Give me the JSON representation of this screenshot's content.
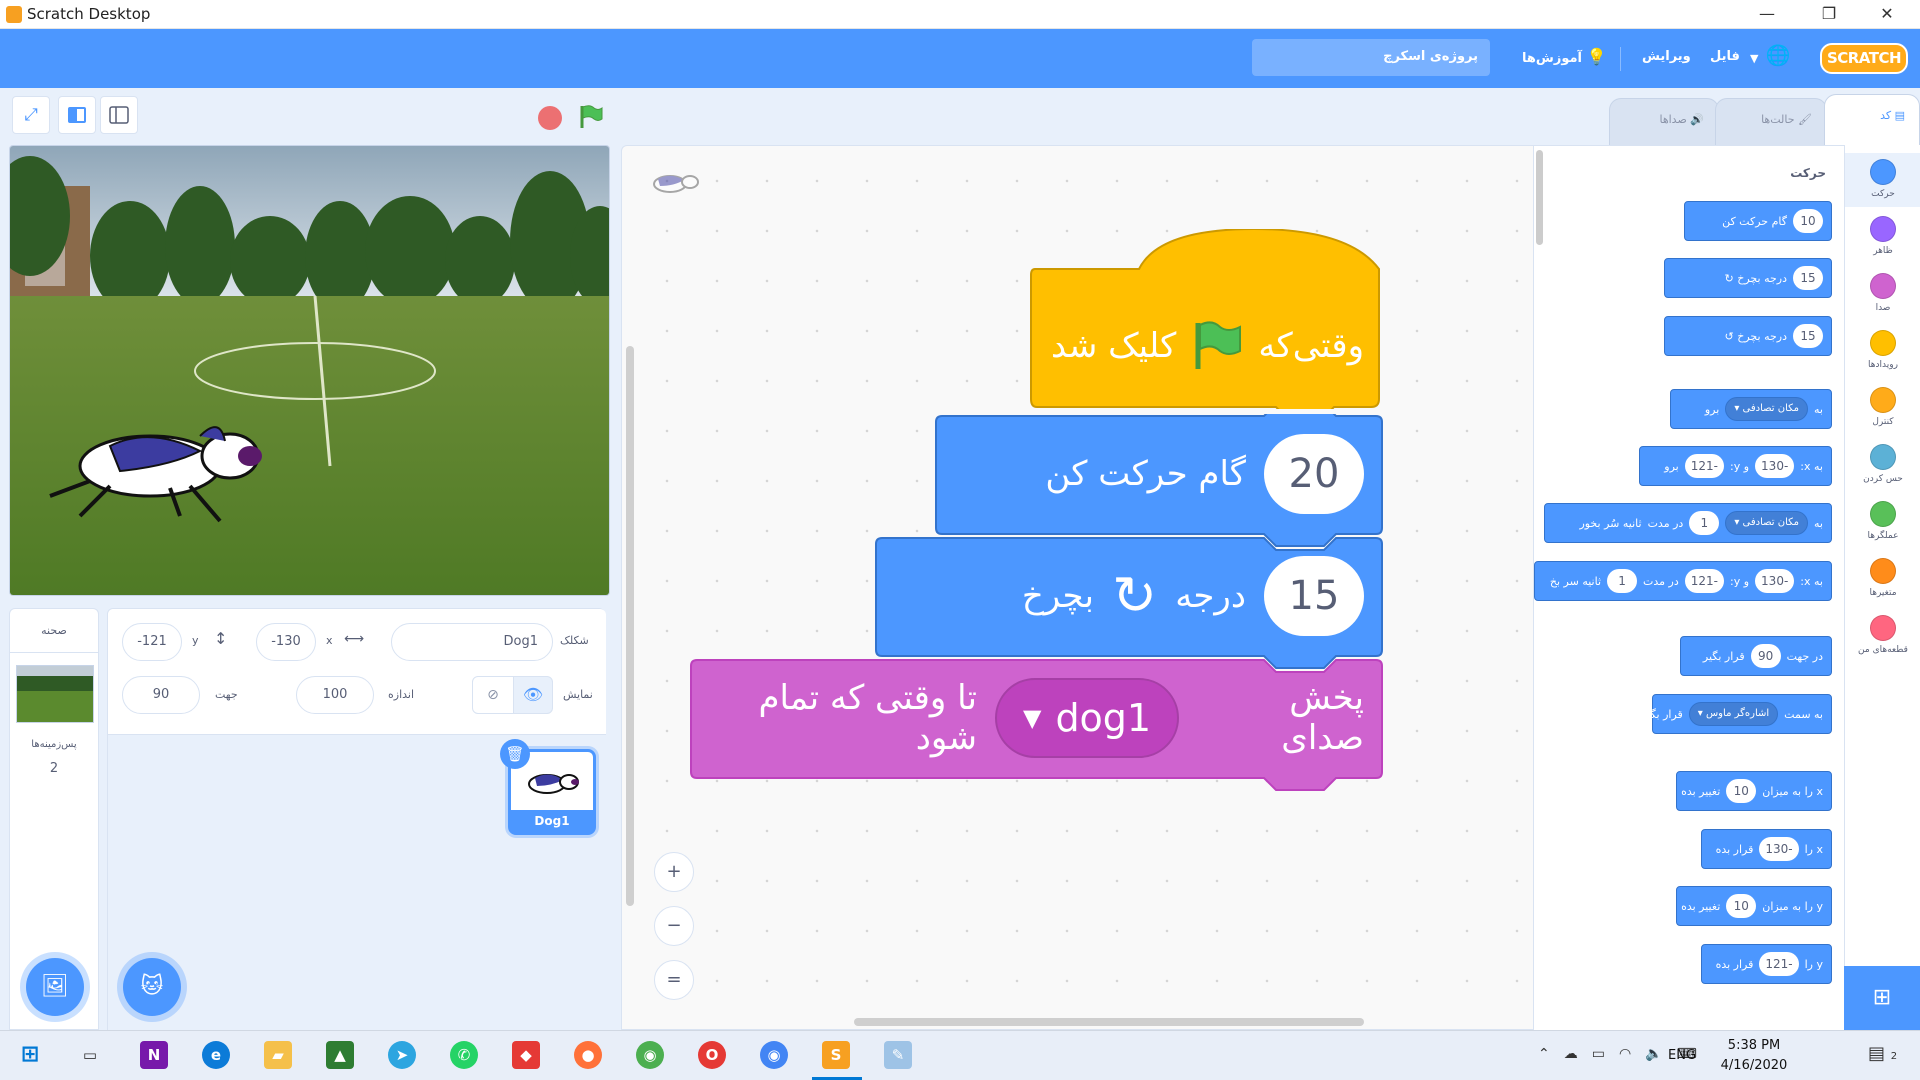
{
  "window": {
    "title": "Scratch Desktop",
    "minimize": "—",
    "restore": "❐",
    "close": "✕"
  },
  "menubar": {
    "logo": "SCRATCH",
    "file": "فایل",
    "edit": "ویرایش",
    "tutorials": "آموزش‌ها",
    "project_title": "پروژه‌ی اسکرچ"
  },
  "tabs": {
    "code": "کد",
    "costumes": "حالت‌ها",
    "sounds": "صداها"
  },
  "sprite_info": {
    "sprite_label": "شکلک",
    "sprite_name": "Dog1",
    "x_label": "x",
    "x_value": "-130",
    "y_label": "y",
    "y_value": "-121",
    "show_label": "نمایش",
    "size_label": "اندازه",
    "size_value": "100",
    "direction_label": "جهت",
    "direction_value": "90"
  },
  "stage_panel": {
    "header": "صحنه",
    "backdrops_label": "پس‌زمینه‌ها",
    "backdrops_count": "2"
  },
  "sprite_thumb": {
    "name": "Dog1"
  },
  "script": {
    "hat": {
      "before": "وقتی‌که",
      "after": "کلیک شد"
    },
    "move": {
      "value": "20",
      "text": "گام حرکت کن"
    },
    "turn": {
      "value": "15",
      "text1": "درجه",
      "text2": "بچرخ"
    },
    "sound": {
      "text1": "پخش صدای",
      "dropdown": "dog1",
      "text2": "تا وقتی که تمام شود"
    }
  },
  "palette": {
    "section_title": "حرکت",
    "blocks": [
      {
        "text": "گام حرکت کن",
        "value": "10"
      },
      {
        "text": "درجه بچرخ ↻",
        "value": "15"
      },
      {
        "text": "درجه بچرخ ↺",
        "value": "15"
      },
      {
        "pre": "به",
        "dropdown": "مکان تصادفی",
        "post": "برو"
      },
      {
        "pre": "به x:",
        "v1": "-130",
        "mid": "و y:",
        "v2": "-121",
        "post": "برو"
      },
      {
        "pre": "به",
        "dropdown": "مکان تصادفی",
        "mid": "در مدت",
        "v1": "1",
        "post": "ثانیه سُر بخور"
      },
      {
        "pre": "به x:",
        "v1": "-130",
        "mid": "و y:",
        "v2": "-121",
        "mid2": "در مدت",
        "v3": "1",
        "post": "ثانیه سر بخ"
      },
      {
        "pre": "در جهت",
        "v1": "90",
        "post": "قرار بگیر"
      },
      {
        "pre": "به سمت",
        "dropdown": "اشاره‌گر ماوس",
        "post": "قرار بگیر"
      },
      {
        "pre": "x را به میزان",
        "v1": "10",
        "post": "تغییر بده"
      },
      {
        "pre": "x را",
        "v1": "-130",
        "post": "قرار بده"
      },
      {
        "pre": "y را به میزان",
        "v1": "10",
        "post": "تغییر بده"
      },
      {
        "pre": "y را",
        "v1": "-121",
        "post": "قرار بده"
      }
    ]
  },
  "categories": [
    {
      "label": "حرکت",
      "color": "#4c97ff"
    },
    {
      "label": "ظاهر",
      "color": "#9966ff"
    },
    {
      "label": "صدا",
      "color": "#cf63cf"
    },
    {
      "label": "رویدادها",
      "color": "#ffbf00"
    },
    {
      "label": "کنترل",
      "color": "#ffab19"
    },
    {
      "label": "حس کردن",
      "color": "#5cb1d6"
    },
    {
      "label": "عملگرها",
      "color": "#59c059"
    },
    {
      "label": "متغیرها",
      "color": "#ff8c1a"
    },
    {
      "label": "قطعه‌های من",
      "color": "#ff6680"
    }
  ],
  "zoom": {
    "in": "+",
    "out": "−",
    "reset": "="
  },
  "taskbar": {
    "lang": "ENG",
    "time": "5:38 PM",
    "date": "4/16/2020",
    "notifications": "2"
  }
}
